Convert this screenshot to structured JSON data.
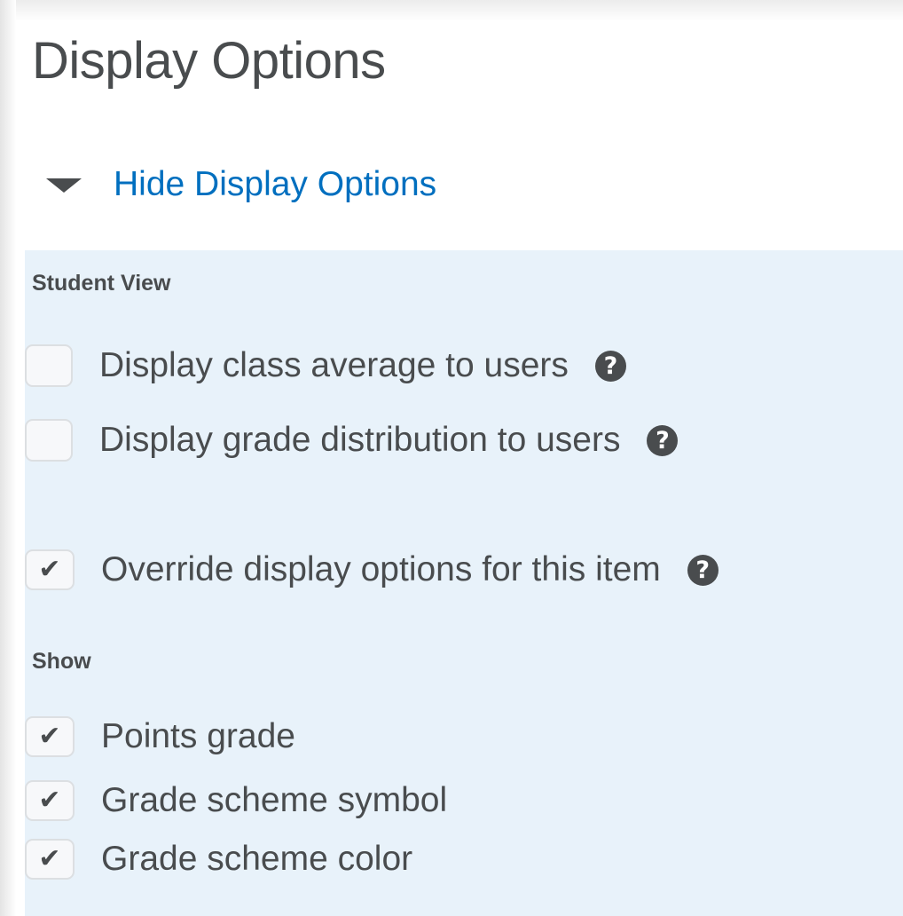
{
  "page": {
    "title": "Display Options"
  },
  "toggle": {
    "icon": "caret-down-icon",
    "label": "Hide Display Options"
  },
  "student_view": {
    "heading": "Student View",
    "options": [
      {
        "label": "Display class average to users",
        "checked": false,
        "help_icon": "help-icon",
        "help_glyph": "?"
      },
      {
        "label": "Display grade distribution to users",
        "checked": false,
        "help_icon": "help-icon",
        "help_glyph": "?"
      }
    ]
  },
  "override": {
    "label": "Override display options for this item",
    "checked": true,
    "help_icon": "help-icon",
    "help_glyph": "?"
  },
  "show": {
    "heading": "Show",
    "options": [
      {
        "label": "Points grade",
        "checked": true
      },
      {
        "label": "Grade scheme symbol",
        "checked": true
      },
      {
        "label": "Grade scheme color",
        "checked": true
      }
    ]
  },
  "check_glyph": "✔",
  "colors": {
    "link": "#006fbf",
    "text": "#494c4e",
    "panel_background": "#e8f2fa"
  }
}
